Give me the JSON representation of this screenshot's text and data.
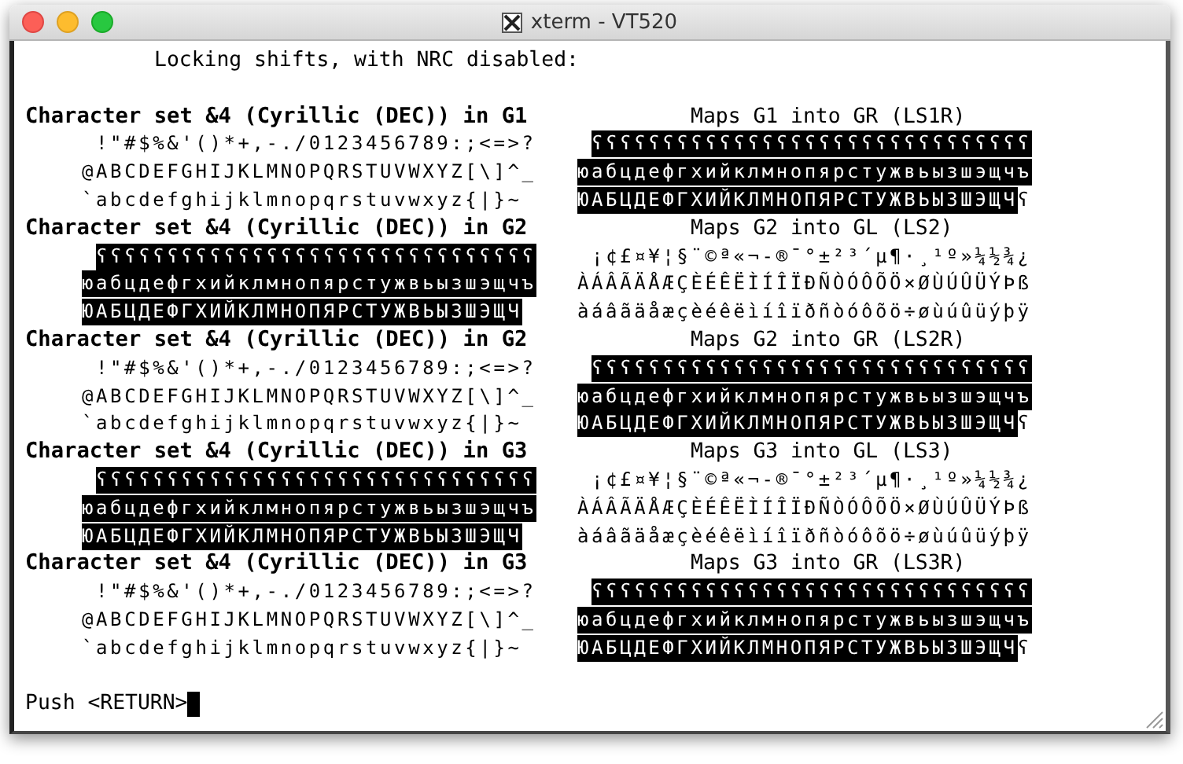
{
  "window": {
    "title": "xterm - VT520"
  },
  "terminal": {
    "heading": "Locking shifts, with NRC disabled:",
    "sections": [
      {
        "left": {
          "header": "Character set &4 (Cyrillic (DEC)) in G1",
          "rows": [
            [
              {
                "text": "!\"#$%&'()*+,-./0123456789:;<=>?",
                "inverse": false
              }
            ],
            [
              {
                "text": "@ABCDEFGHIJKLMNOPQRSTUVWXYZ[\\]^_",
                "inverse": false
              }
            ],
            [
              {
                "text": "`abcdefghijklmnopqrstuvwxyz{|}~",
                "inverse": false
              }
            ]
          ]
        },
        "right": {
          "header": "Maps G1 into GR (LS1R)",
          "rows": [
            [
              {
                "text": "ʕʕʕʕʕʕʕʕʕʕʕʕʕʕʕʕʕʕʕʕʕʕʕʕʕʕʕʕʕʕʕ",
                "inverse": true
              }
            ],
            [
              {
                "text": "юабцдефгхийклмнопярстужвьызшэщчъ",
                "inverse": true
              }
            ],
            [
              {
                "text": "ЮАБЦДЕФГХИЙКЛМНОПЯРСТУЖВЬЫЗШЭЩЧ",
                "inverse": true
              },
              {
                "text": "ʕ",
                "inverse": false
              }
            ]
          ]
        }
      },
      {
        "left": {
          "header": "Character set &4 (Cyrillic (DEC)) in G2",
          "rows": [
            [
              {
                "text": "ʕʕʕʕʕʕʕʕʕʕʕʕʕʕʕʕʕʕʕʕʕʕʕʕʕʕʕʕʕʕʕ",
                "inverse": true
              }
            ],
            [
              {
                "text": "юабцдефгхийклмнопярстужвьызшэщчъ",
                "inverse": true
              }
            ],
            [
              {
                "text": "ЮАБЦДЕФГХИЙКЛМНОПЯРСТУЖВЬЫЗШЭЩЧ",
                "inverse": true
              }
            ]
          ]
        },
        "right": {
          "header": "Maps G2 into GL (LS2)",
          "rows": [
            [
              {
                "text": "¡¢£¤¥¦§¨©ª«¬-®¯°±²³´µ¶·¸¹º»¼½¾¿",
                "inverse": false
              }
            ],
            [
              {
                "text": "ÀÁÂÃÄÅÆÇÈÉÊËÌÍÎÏÐÑÒÓÔÕÖ×ØÙÚÛÜÝÞß",
                "inverse": false
              }
            ],
            [
              {
                "text": "àáâãäåæçèéêëìíîïðñòóôõö÷øùúûüýþÿ",
                "inverse": false
              }
            ]
          ]
        }
      },
      {
        "left": {
          "header": "Character set &4 (Cyrillic (DEC)) in G2",
          "rows": [
            [
              {
                "text": "!\"#$%&'()*+,-./0123456789:;<=>?",
                "inverse": false
              }
            ],
            [
              {
                "text": "@ABCDEFGHIJKLMNOPQRSTUVWXYZ[\\]^_",
                "inverse": false
              }
            ],
            [
              {
                "text": "`abcdefghijklmnopqrstuvwxyz{|}~",
                "inverse": false
              }
            ]
          ]
        },
        "right": {
          "header": "Maps G2 into GR (LS2R)",
          "rows": [
            [
              {
                "text": "ʕʕʕʕʕʕʕʕʕʕʕʕʕʕʕʕʕʕʕʕʕʕʕʕʕʕʕʕʕʕʕ",
                "inverse": true
              }
            ],
            [
              {
                "text": "юабцдефгхийклмнопярстужвьызшэщчъ",
                "inverse": true
              }
            ],
            [
              {
                "text": "ЮАБЦДЕФГХИЙКЛМНОПЯРСТУЖВЬЫЗШЭЩЧ",
                "inverse": true
              },
              {
                "text": "ʕ",
                "inverse": false
              }
            ]
          ]
        }
      },
      {
        "left": {
          "header": "Character set &4 (Cyrillic (DEC)) in G3",
          "rows": [
            [
              {
                "text": "ʕʕʕʕʕʕʕʕʕʕʕʕʕʕʕʕʕʕʕʕʕʕʕʕʕʕʕʕʕʕʕ",
                "inverse": true
              }
            ],
            [
              {
                "text": "юабцдефгхийклмнопярстужвьызшэщчъ",
                "inverse": true
              }
            ],
            [
              {
                "text": "ЮАБЦДЕФГХИЙКЛМНОПЯРСТУЖВЬЫЗШЭЩЧ",
                "inverse": true
              }
            ]
          ]
        },
        "right": {
          "header": "Maps G3 into GL (LS3)",
          "rows": [
            [
              {
                "text": "¡¢£¤¥¦§¨©ª«¬-®¯°±²³´µ¶·¸¹º»¼½¾¿",
                "inverse": false
              }
            ],
            [
              {
                "text": "ÀÁÂÃÄÅÆÇÈÉÊËÌÍÎÏÐÑÒÓÔÕÖ×ØÙÚÛÜÝÞß",
                "inverse": false
              }
            ],
            [
              {
                "text": "àáâãäåæçèéêëìíîïðñòóôõö÷øùúûüýþÿ",
                "inverse": false
              }
            ]
          ]
        }
      },
      {
        "left": {
          "header": "Character set &4 (Cyrillic (DEC)) in G3",
          "rows": [
            [
              {
                "text": "!\"#$%&'()*+,-./0123456789:;<=>?",
                "inverse": false
              }
            ],
            [
              {
                "text": "@ABCDEFGHIJKLMNOPQRSTUVWXYZ[\\]^_",
                "inverse": false
              }
            ],
            [
              {
                "text": "`abcdefghijklmnopqrstuvwxyz{|}~",
                "inverse": false
              }
            ]
          ]
        },
        "right": {
          "header": "Maps G3 into GR (LS3R)",
          "rows": [
            [
              {
                "text": "ʕʕʕʕʕʕʕʕʕʕʕʕʕʕʕʕʕʕʕʕʕʕʕʕʕʕʕʕʕʕʕ",
                "inverse": true
              }
            ],
            [
              {
                "text": "юабцдефгхийклмнопярстужвьызшэщчъ",
                "inverse": true
              }
            ],
            [
              {
                "text": "ЮАБЦДЕФГХИЙКЛМНОПЯРСТУЖВЬЫЗШЭЩЧ",
                "inverse": true
              },
              {
                "text": "ʕ",
                "inverse": false
              }
            ]
          ]
        }
      }
    ],
    "prompt": "Push <RETURN>"
  }
}
